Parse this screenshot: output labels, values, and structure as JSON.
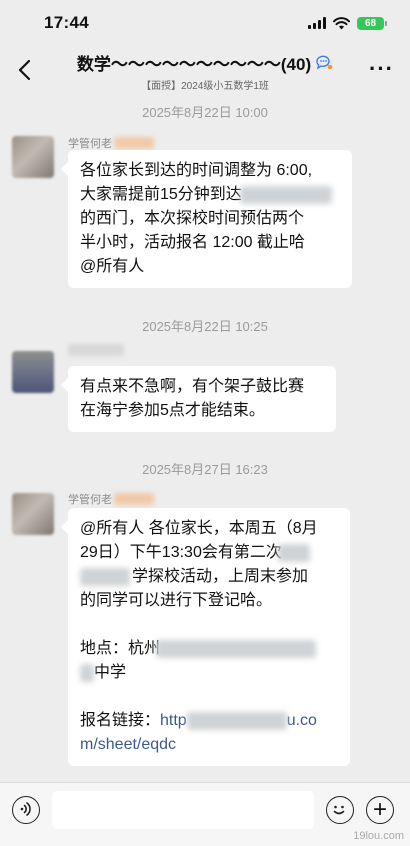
{
  "status": {
    "time": "17:44",
    "battery": "68"
  },
  "header": {
    "title": "数学～～～～～～～～～～(40)",
    "subtitle": "【面授】2024级小五数学1班"
  },
  "messages": [
    {
      "timestamp": "2025年8月22日 10:00",
      "sender": "学管何老",
      "lines": [
        "各位家长到达的时间调整为 6:00,",
        "大家需提前15分钟到达",
        "的西门，本次探校时间预估两个",
        "半小时，活动报名 12:00 截止哈",
        "@所有人"
      ]
    },
    {
      "timestamp": "2025年8月22日 10:25",
      "sender": "",
      "lines": [
        "有点来不急啊，有个架子鼓比赛",
        "在海宁参加5点才能结束。"
      ]
    },
    {
      "timestamp": "2025年8月27日 16:23",
      "sender": "学管何老",
      "lines": [
        "@所有人 各位家长，本周五（8月",
        "29日）下午13:30会有第二次",
        "学探校活动，上周末参加",
        "的同学可以进行下登记哈。",
        "",
        "地点：杭州",
        "中学",
        "",
        "报名链接：",
        "http",
        "u.co",
        "m/sheet/eqdc"
      ]
    }
  ],
  "input": {
    "placeholder": ""
  },
  "watermark": "19lou.com",
  "colors": {
    "bubble": "#ffffff",
    "background": "#ededed",
    "link": "#3c5a8c",
    "battery": "#34c759"
  }
}
